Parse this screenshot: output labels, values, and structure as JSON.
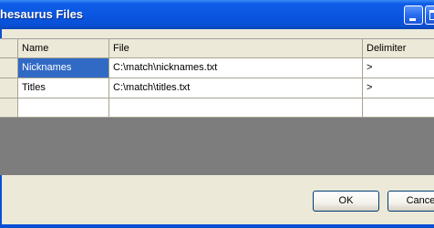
{
  "window": {
    "title": "Thesaurus Files",
    "title_visible": "hesaurus Files"
  },
  "grid": {
    "columns": [
      "Name",
      "File",
      "Delimiter"
    ],
    "rows": [
      {
        "name": "Nicknames",
        "file": "C:\\match\\nicknames.txt",
        "delimiter": ">"
      },
      {
        "name": "Titles",
        "file": "C:\\match\\titles.txt",
        "delimiter": ">"
      },
      {
        "name": "",
        "file": "",
        "delimiter": ""
      }
    ]
  },
  "buttons": {
    "ok": "OK",
    "cancel": "Cance"
  },
  "colors": {
    "titlebar": "#0a55e0",
    "selection": "#316ac5",
    "grid_empty": "#7d7d7d",
    "dialog_bg": "#ece9d8"
  }
}
